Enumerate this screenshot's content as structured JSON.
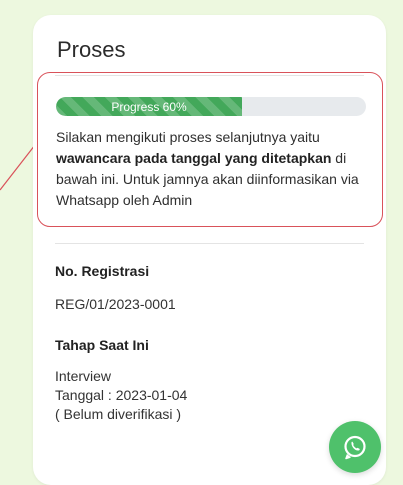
{
  "card": {
    "title": "Proses"
  },
  "progress": {
    "label": "Progress 60%",
    "value": 60,
    "fill_color": "#43a85a"
  },
  "notice": {
    "before": "Silakan mengikuti proses selanjutnya yaitu ",
    "bold": "wawancara pada tanggal yang ditetapkan",
    "after": " di bawah ini. Untuk jamnya akan diinformasikan via Whatsapp oleh Admin",
    "border_color": "#d9525a"
  },
  "registration": {
    "label": "No. Registrasi",
    "value": "REG/01/2023-0001"
  },
  "stage": {
    "label": "Tahap Saat Ini",
    "name": "Interview",
    "date_line": "Tanggal : 2023-01-04",
    "status": "( Belum diverifikasi )"
  },
  "whatsapp": {
    "icon": "whatsapp-icon",
    "color": "#4fc16b"
  }
}
